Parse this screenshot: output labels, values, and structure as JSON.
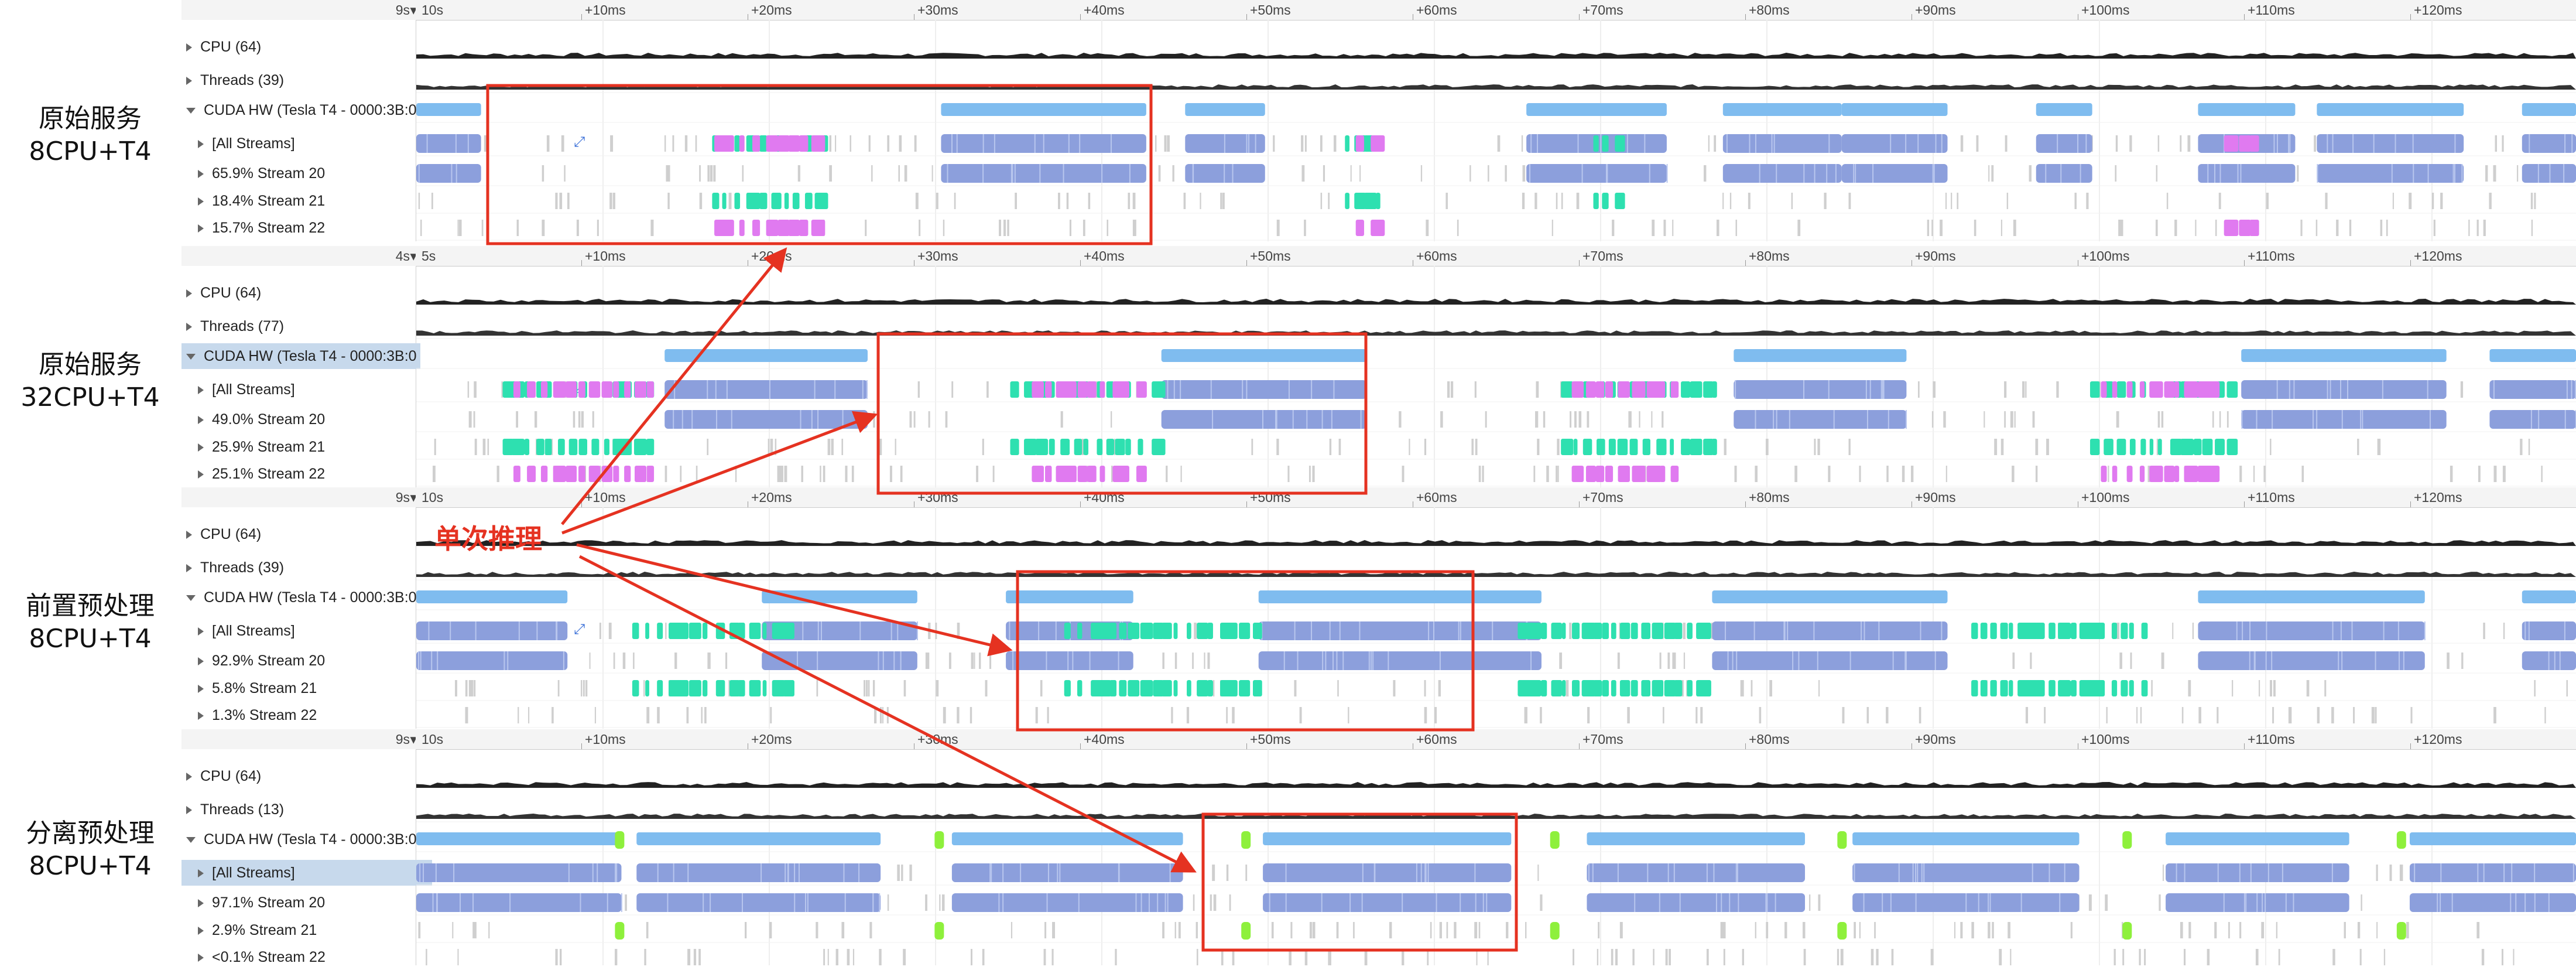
{
  "panels": [
    {
      "caption": [
        "原始服务",
        "8CPU+T4"
      ],
      "ruler": {
        "head": "9s",
        "start": "10s",
        "ticks": [
          "+10ms",
          "+20ms",
          "+30ms",
          "+40ms",
          "+50ms",
          "+60ms",
          "+70ms",
          "+80ms",
          "+90ms",
          "+100ms",
          "+110ms",
          "+120ms"
        ]
      },
      "rows": [
        {
          "label": "CPU (64)",
          "open": false,
          "sel": false
        },
        {
          "label": "Threads (39)",
          "open": false,
          "sel": false
        },
        {
          "label": "CUDA HW (Tesla T4 - 0000:3B:0",
          "open": true,
          "sel": false
        },
        {
          "label": "[All Streams]",
          "open": false,
          "sel": false
        },
        {
          "label": "65.9% Stream 20",
          "open": false,
          "sel": false
        },
        {
          "label": "18.4% Stream 21",
          "open": false,
          "sel": false
        },
        {
          "label": "15.7% Stream 22",
          "open": false,
          "sel": false
        }
      ]
    },
    {
      "caption": [
        "原始服务",
        "32CPU+T4"
      ],
      "ruler": {
        "head": "4s",
        "start": "5s",
        "ticks": [
          "+10ms",
          "+20ms",
          "+30ms",
          "+40ms",
          "+50ms",
          "+60ms",
          "+70ms",
          "+80ms",
          "+90ms",
          "+100ms",
          "+110ms",
          "+120ms"
        ]
      },
      "rows": [
        {
          "label": "CPU (64)",
          "open": false,
          "sel": false
        },
        {
          "label": "Threads (77)",
          "open": false,
          "sel": false
        },
        {
          "label": "CUDA HW (Tesla T4 - 0000:3B:0",
          "open": true,
          "sel": true
        },
        {
          "label": "[All Streams]",
          "open": false,
          "sel": false
        },
        {
          "label": "49.0% Stream 20",
          "open": false,
          "sel": false
        },
        {
          "label": "25.9% Stream 21",
          "open": false,
          "sel": false
        },
        {
          "label": "25.1% Stream 22",
          "open": false,
          "sel": false
        }
      ]
    },
    {
      "caption": [
        "前置预处理",
        "8CPU+T4"
      ],
      "ruler": {
        "head": "9s",
        "start": "10s",
        "ticks": [
          "+10ms",
          "+20ms",
          "+30ms",
          "+40ms",
          "+50ms",
          "+60ms",
          "+70ms",
          "+80ms",
          "+90ms",
          "+100ms",
          "+110ms",
          "+120ms"
        ]
      },
      "rows": [
        {
          "label": "CPU (64)",
          "open": false,
          "sel": false
        },
        {
          "label": "Threads (39)",
          "open": false,
          "sel": false
        },
        {
          "label": "CUDA HW (Tesla T4 - 0000:3B:0",
          "open": true,
          "sel": false
        },
        {
          "label": "[All Streams]",
          "open": false,
          "sel": false
        },
        {
          "label": "92.9% Stream 20",
          "open": false,
          "sel": false
        },
        {
          "label": "5.8% Stream 21",
          "open": false,
          "sel": false
        },
        {
          "label": "1.3% Stream 22",
          "open": false,
          "sel": false
        }
      ]
    },
    {
      "caption": [
        "分离预处理",
        "8CPU+T4"
      ],
      "ruler": {
        "head": "9s",
        "start": "10s",
        "ticks": [
          "+10ms",
          "+20ms",
          "+30ms",
          "+40ms",
          "+50ms",
          "+60ms",
          "+70ms",
          "+80ms",
          "+90ms",
          "+100ms",
          "+110ms",
          "+120ms"
        ]
      },
      "rows": [
        {
          "label": "CPU (64)",
          "open": false,
          "sel": false
        },
        {
          "label": "Threads (13)",
          "open": false,
          "sel": false
        },
        {
          "label": "CUDA HW (Tesla T4 - 0000:3B:0",
          "open": true,
          "sel": false
        },
        {
          "label": "[All Streams]",
          "open": false,
          "sel": true
        },
        {
          "label": "97.1% Stream 20",
          "open": false,
          "sel": false
        },
        {
          "label": "2.9% Stream 21",
          "open": false,
          "sel": false
        },
        {
          "label": "<0.1% Stream 22",
          "open": false,
          "sel": false
        }
      ]
    }
  ],
  "annotation": {
    "label": "单次推理",
    "color": "#e53221"
  },
  "colors": {
    "kernel_blue": "#8c9fdc",
    "cpu_blue": "#7fbcef",
    "memcpy_teal": "#2ee0b0",
    "memcpy_pink": "#e07af0",
    "memset_green": "#8ef03c",
    "idle_gray": "#d9d9d9"
  }
}
